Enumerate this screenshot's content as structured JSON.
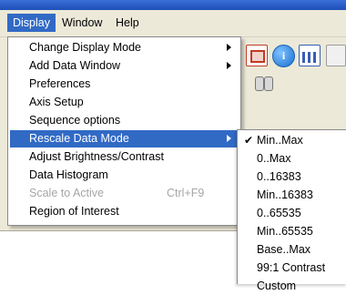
{
  "menubar": {
    "items": [
      "Display",
      "Window",
      "Help"
    ]
  },
  "display_menu": {
    "items": [
      {
        "label": "Change Display Mode",
        "submenu": true
      },
      {
        "label": "Add Data Window",
        "submenu": true
      },
      {
        "label": "Preferences"
      },
      {
        "label": "Axis Setup"
      },
      {
        "label": "Sequence options"
      },
      {
        "label": "Rescale Data Mode",
        "submenu": true,
        "highlighted": true
      },
      {
        "label": "Adjust Brightness/Contrast"
      },
      {
        "label": "Data Histogram"
      },
      {
        "label": "Scale to Active",
        "shortcut": "Ctrl+F9",
        "disabled": true
      },
      {
        "label": "Region of Interest"
      }
    ]
  },
  "rescale_submenu": {
    "checked_index": 0,
    "check_glyph": "✔",
    "items": [
      "Min..Max",
      "0..Max",
      "0..16383",
      "Min..16383",
      "0..65535",
      "Min..65535",
      "Base..Max",
      "99:1 Contrast",
      "Custom"
    ]
  },
  "toolbar": {
    "icons": [
      "roi-icon",
      "info-icon",
      "histogram-chart-icon",
      "binoculars-icon"
    ],
    "info_glyph": "i"
  },
  "colors": {
    "menubar_bg": "#ece9d8",
    "highlight": "#316ac5",
    "disabled_text": "#a6a6a6"
  }
}
